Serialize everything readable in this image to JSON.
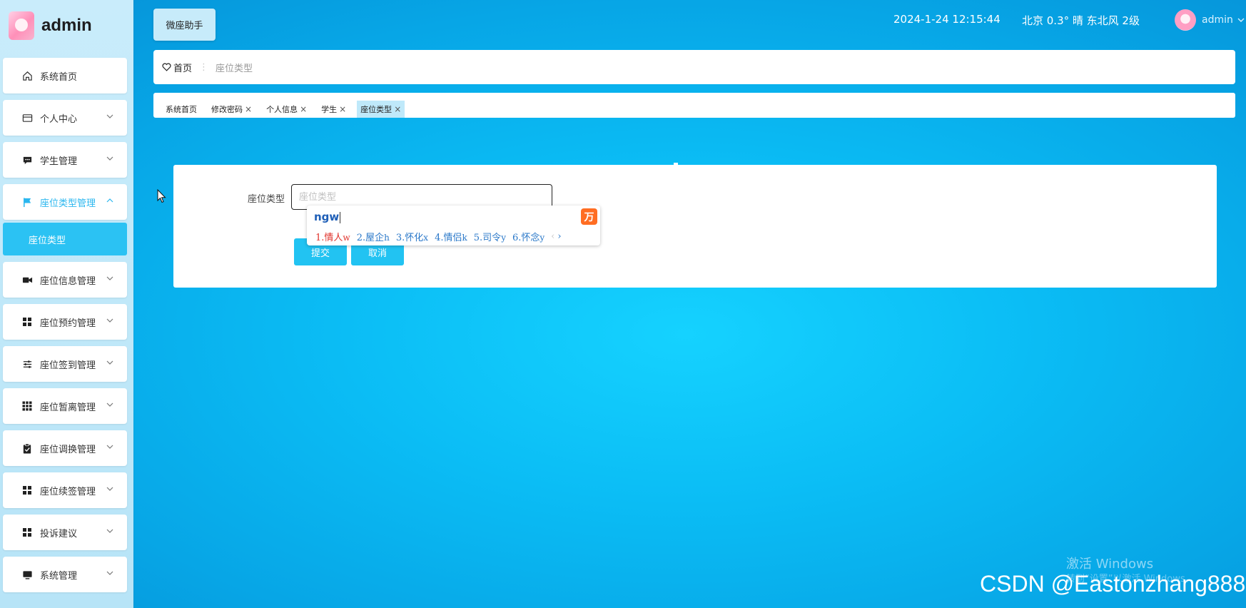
{
  "sidebar": {
    "brand": "admin",
    "items": [
      {
        "label": "系统首页",
        "icon": "home-icon"
      },
      {
        "label": "个人中心",
        "icon": "card-icon"
      },
      {
        "label": "学生管理",
        "icon": "chat-icon"
      },
      {
        "label": "座位类型管理",
        "icon": "flag-icon"
      },
      {
        "label": "座位信息管理",
        "icon": "video-icon"
      },
      {
        "label": "座位预约管理",
        "icon": "grid-icon"
      },
      {
        "label": "座位签到管理",
        "icon": "sliders-icon"
      },
      {
        "label": "座位暂离管理",
        "icon": "grid9-icon"
      },
      {
        "label": "座位调换管理",
        "icon": "clipboard-check-icon"
      },
      {
        "label": "座位续签管理",
        "icon": "grid-icon"
      },
      {
        "label": "投诉建议",
        "icon": "grid-icon"
      },
      {
        "label": "系统管理",
        "icon": "monitor-icon"
      }
    ],
    "submenu": {
      "label": "座位类型"
    }
  },
  "header": {
    "assistant_label": "微座助手",
    "datetime": "2024-1-24 12:15:44",
    "weather": "北京  0.3°  晴  东北风  2级",
    "user_name": "admin"
  },
  "breadcrumb": {
    "home": "首页",
    "separator": "⋮",
    "current": "座位类型"
  },
  "tabs": [
    {
      "label": "系统首页"
    },
    {
      "label": "修改密码",
      "close": "×"
    },
    {
      "label": "个人信息",
      "close": "×"
    },
    {
      "label": "学生",
      "close": "×"
    },
    {
      "label": "座位类型",
      "close": "×"
    }
  ],
  "form": {
    "field_label": "座位类型",
    "placeholder": "座位类型",
    "submit_label": "提交",
    "cancel_label": "取消"
  },
  "ime": {
    "input": "ngw",
    "logo_char": "万",
    "candidates": [
      {
        "num": "1.",
        "word": "情人",
        "hint": "w"
      },
      {
        "num": "2.",
        "word": "屋企",
        "hint": "h"
      },
      {
        "num": "3.",
        "word": "怀化",
        "hint": "x"
      },
      {
        "num": "4.",
        "word": "情侣",
        "hint": "k"
      },
      {
        "num": "5.",
        "word": "司令",
        "hint": "y"
      },
      {
        "num": "6.",
        "word": "怀念",
        "hint": "y"
      }
    ],
    "prev": "‹",
    "next": "›"
  },
  "watermark": {
    "windows": "激活 Windows",
    "windows_sub": "转到“设置”以激活 Windows。",
    "csdn": "CSDN @Eastonzhang888"
  },
  "colors": {
    "accent": "#22c3f2",
    "active_text": "#2bb7ef",
    "ime_first": "#e0322b",
    "ime_text": "#2a78c9",
    "ime_logo": "#ff6d22"
  }
}
